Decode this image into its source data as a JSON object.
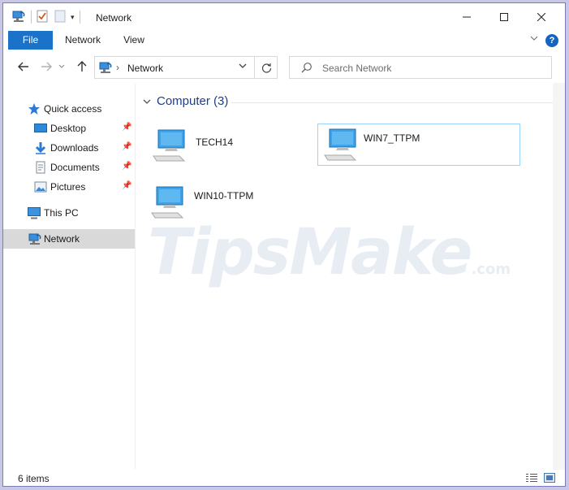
{
  "window": {
    "title": "Network"
  },
  "ribbon": {
    "tabs": [
      "File",
      "Network",
      "View"
    ]
  },
  "address": {
    "location": "Network"
  },
  "search": {
    "placeholder": "Search Network"
  },
  "nav": {
    "items": [
      {
        "label": "Quick access",
        "icon": "star-icon",
        "pinned": false
      },
      {
        "label": "Desktop",
        "icon": "desktop-folder-icon",
        "pinned": true
      },
      {
        "label": "Downloads",
        "icon": "download-arrow-icon",
        "pinned": true
      },
      {
        "label": "Documents",
        "icon": "documents-icon",
        "pinned": true
      },
      {
        "label": "Pictures",
        "icon": "pictures-icon",
        "pinned": true
      },
      {
        "label": "This PC",
        "icon": "this-pc-icon",
        "pinned": false
      },
      {
        "label": "Network",
        "icon": "network-icon",
        "pinned": false,
        "selected": true
      }
    ]
  },
  "content": {
    "group_header": "Computer (3)",
    "computers": [
      {
        "name": "TECH14",
        "selected": false
      },
      {
        "name": "WIN7_TTPM",
        "selected": true
      },
      {
        "name": "WIN10-TTPM",
        "selected": false
      }
    ]
  },
  "watermark": {
    "text": "TipsMake",
    "suffix": ".com"
  },
  "status": {
    "items_count": "6 items"
  },
  "colors": {
    "accent": "#1a73c8",
    "selected_nav": "#d9d9d9",
    "selection_border": "#99d1ff",
    "header_text": "#1e3e8a"
  }
}
